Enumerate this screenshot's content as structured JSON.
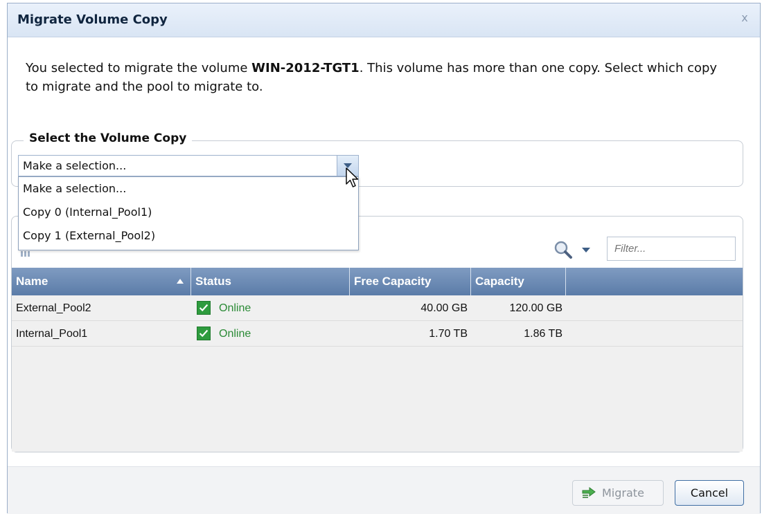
{
  "dialog": {
    "title": "Migrate Volume Copy",
    "close_label": "x"
  },
  "intro": {
    "prefix": "You selected to migrate the volume ",
    "volume_name": "WIN-2012-TGT1",
    "suffix": ". This volume has more than one copy. Select which copy to migrate and the pool to migrate to."
  },
  "volume_copy": {
    "legend": "Select the Volume Copy",
    "selected_value": "Make a selection...",
    "options": [
      "Make a selection...",
      "Copy 0 (Internal_Pool1)",
      "Copy 1 (External_Pool2)"
    ]
  },
  "pools": {
    "filter_placeholder": "Filter...",
    "columns": [
      "Name",
      "Status",
      "Free Capacity",
      "Capacity"
    ],
    "sort_column": "Name",
    "sort_direction": "ascending",
    "rows": [
      {
        "name": "External_Pool2",
        "status": "Online",
        "free": "40.00 GB",
        "capacity": "120.00 GB"
      },
      {
        "name": "Internal_Pool1",
        "status": "Online",
        "free": "1.70 TB",
        "capacity": "1.86 TB"
      }
    ]
  },
  "footer": {
    "migrate_label": "Migrate",
    "cancel_label": "Cancel"
  },
  "icons": {
    "status_online": "checkmark-icon",
    "search": "search-icon",
    "migrate": "migrate-arrow-icon",
    "columns": "column-selector-icon"
  },
  "colors": {
    "header_blue": "#5b7ca8",
    "online_green": "#2e9b3e",
    "title_bg": "#d9e5f4"
  }
}
